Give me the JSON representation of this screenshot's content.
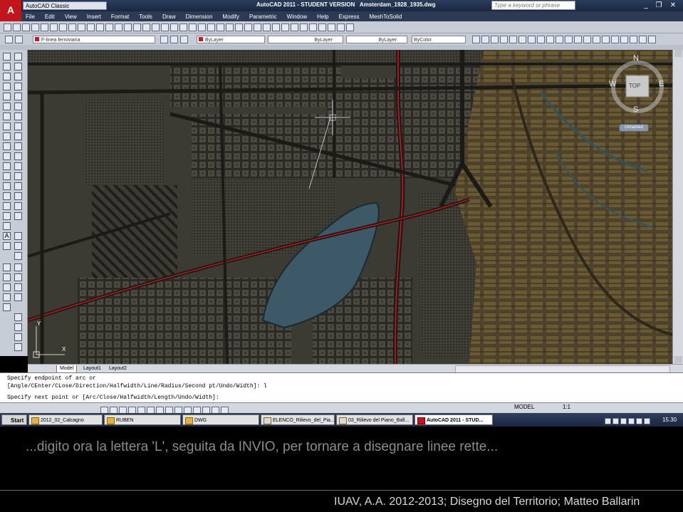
{
  "window": {
    "workspace": "AutoCAD Classic",
    "title": "AutoCAD 2011 - STUDENT VERSION",
    "filename": "Amsterdam_1928_1935.dwg",
    "search_placeholder": "Type a keyword or phrase",
    "logo": "A"
  },
  "menu": [
    "File",
    "Edit",
    "View",
    "Insert",
    "Format",
    "Tools",
    "Draw",
    "Dimension",
    "Modify",
    "Parametric",
    "Window",
    "Help",
    "Express",
    "MeshToSolid"
  ],
  "properties_toolbar": {
    "layer": "F-linea ferroviaria",
    "color": "ByLayer",
    "linetype": "ByLayer",
    "lineweight": "ByLayer",
    "plotstyle": "ByColor"
  },
  "viewcube": {
    "north": "N",
    "south": "S",
    "east": "E",
    "west": "W",
    "face": "TOP",
    "ucs": "Unnamed"
  },
  "layout_tabs": [
    "Model",
    "Layout1",
    "Layout2"
  ],
  "ucs_icon": {
    "y": "Y",
    "x": "X"
  },
  "command_line": {
    "line1": "Specify endpoint of arc or",
    "line2": "[Angle/CEnter/CLose/Direction/Halfwidth/Line/Radius/Second pt/Undo/Width]: l",
    "line3": "Specify next point or [Arc/Close/Halfwidth/Length/Undo/Width]:"
  },
  "status": {
    "model": "MODEL",
    "scale": "1:1"
  },
  "taskbar": {
    "start": "Start",
    "tasks": [
      "2012_02_Calcagno",
      "RUBEN",
      "DWG",
      "ELENCO_Rilievo_del_Pia...",
      "03_Rilievo del Piano_Ball...",
      "AutoCAD 2011 - STUD..."
    ],
    "clock": "15.30"
  },
  "caption": "...digito ora la lettera 'L', seguita da INVIO, per tornare a disegnare linee rette...",
  "credit": "IUAV, A.A. 2012-2013; Disegno del Territorio; Matteo Ballarin",
  "colors": {
    "rail": "#d0141c",
    "water": "#3d5867",
    "map_bg": "#3b3a33",
    "map_warm": "#5a4b2a"
  }
}
